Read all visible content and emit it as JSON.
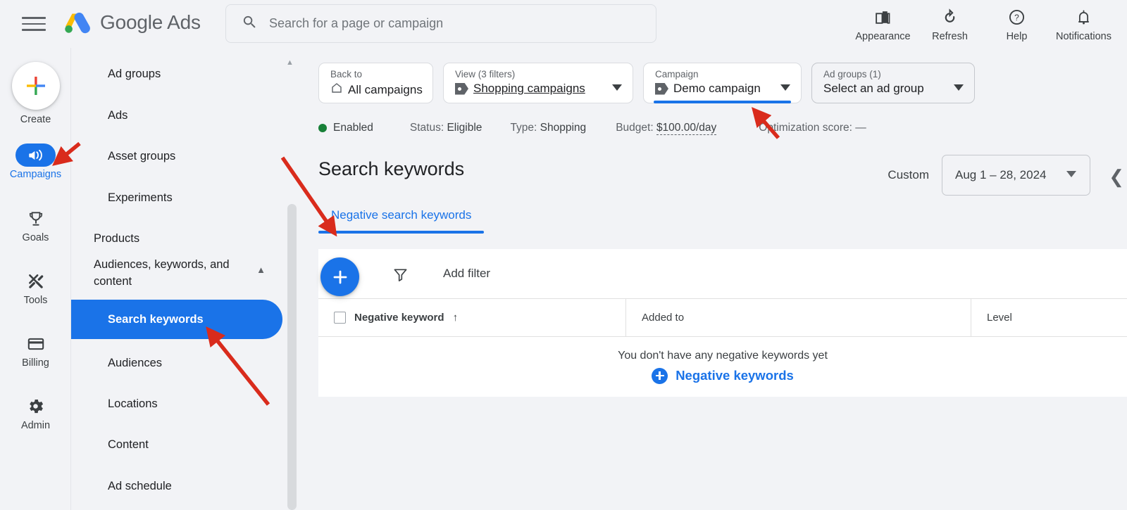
{
  "topbar": {
    "menu_icon": "hamburger-menu-icon",
    "brand": {
      "word1": "Google",
      "word2": "Ads"
    },
    "search": {
      "placeholder": "Search for a page or campaign",
      "value": "",
      "icon": "search-icon"
    },
    "actions": [
      {
        "label": "Appearance",
        "icon": "appearance-icon"
      },
      {
        "label": "Refresh",
        "icon": "refresh-icon"
      },
      {
        "label": "Help",
        "icon": "help-icon"
      },
      {
        "label": "Notifications",
        "icon": "bell-icon"
      }
    ]
  },
  "rail": {
    "create": {
      "label": "Create",
      "icon": "plus-icon"
    },
    "items": [
      {
        "label": "Campaigns",
        "icon": "megaphone-icon",
        "active": true
      },
      {
        "label": "Goals",
        "icon": "trophy-icon",
        "active": false
      },
      {
        "label": "Tools",
        "icon": "tools-icon",
        "active": false
      },
      {
        "label": "Billing",
        "icon": "credit-card-icon",
        "active": false
      },
      {
        "label": "Admin",
        "icon": "gear-icon",
        "active": false
      }
    ]
  },
  "nav": {
    "items": [
      {
        "label": "Ad groups",
        "type": "link",
        "selected": false
      },
      {
        "label": "Ads",
        "type": "link",
        "selected": false
      },
      {
        "label": "Asset groups",
        "type": "link",
        "selected": false
      },
      {
        "label": "Experiments",
        "type": "link",
        "selected": false
      },
      {
        "label": "Products",
        "type": "group",
        "selected": false
      },
      {
        "label": "Audiences, keywords, and content",
        "type": "group",
        "selected": false,
        "expanded": true
      },
      {
        "label": "Search keywords",
        "type": "link",
        "selected": true
      },
      {
        "label": "Audiences",
        "type": "link",
        "selected": false
      },
      {
        "label": "Locations",
        "type": "link",
        "selected": false
      },
      {
        "label": "Content",
        "type": "link",
        "selected": false
      },
      {
        "label": "Ad schedule",
        "type": "link",
        "selected": false
      }
    ]
  },
  "filterbar": {
    "back_to": {
      "caption": "Back to",
      "value": "All campaigns",
      "icon": "home-icon"
    },
    "view": {
      "caption": "View (3 filters)",
      "value": "Shopping campaigns",
      "icon": "tag-icon"
    },
    "campaign": {
      "caption": "Campaign",
      "value": "Demo campaign",
      "icon": "tag-icon",
      "active": true
    },
    "ad_groups": {
      "caption": "Ad groups (1)",
      "value": "Select an ad group"
    }
  },
  "status": {
    "state": "Enabled",
    "state_color": "#188038",
    "status_label": "Status:",
    "status_value": "Eligible",
    "type_label": "Type:",
    "type_value": "Shopping",
    "budget_label": "Budget:",
    "budget_value": "$100.00/day",
    "optimization_label": "Optimization score:",
    "optimization_value": "—"
  },
  "page": {
    "title": "Search keywords",
    "date_preset": "Custom",
    "date_range": "Aug 1 – 28, 2024",
    "collapse_icon": "chevron-left-icon"
  },
  "tabs": [
    {
      "label": "Negative search keywords",
      "active": true
    }
  ],
  "toolbar": {
    "add_button_icon": "plus-icon",
    "filter_icon": "funnel-icon",
    "add_filter_label": "Add filter"
  },
  "table": {
    "columns": [
      {
        "label": "Negative keyword",
        "sort": "↑"
      },
      {
        "label": "Added to",
        "sort": ""
      },
      {
        "label": "Level",
        "sort": ""
      }
    ],
    "rows": [],
    "empty_message": "You don't have any negative keywords yet",
    "empty_cta": "Negative keywords"
  },
  "colors": {
    "accent": "#1a73e8",
    "annotation": "#d92b1c",
    "enabled": "#188038",
    "page_bg": "#f2f3f6",
    "panel_bg": "#ffffff"
  }
}
